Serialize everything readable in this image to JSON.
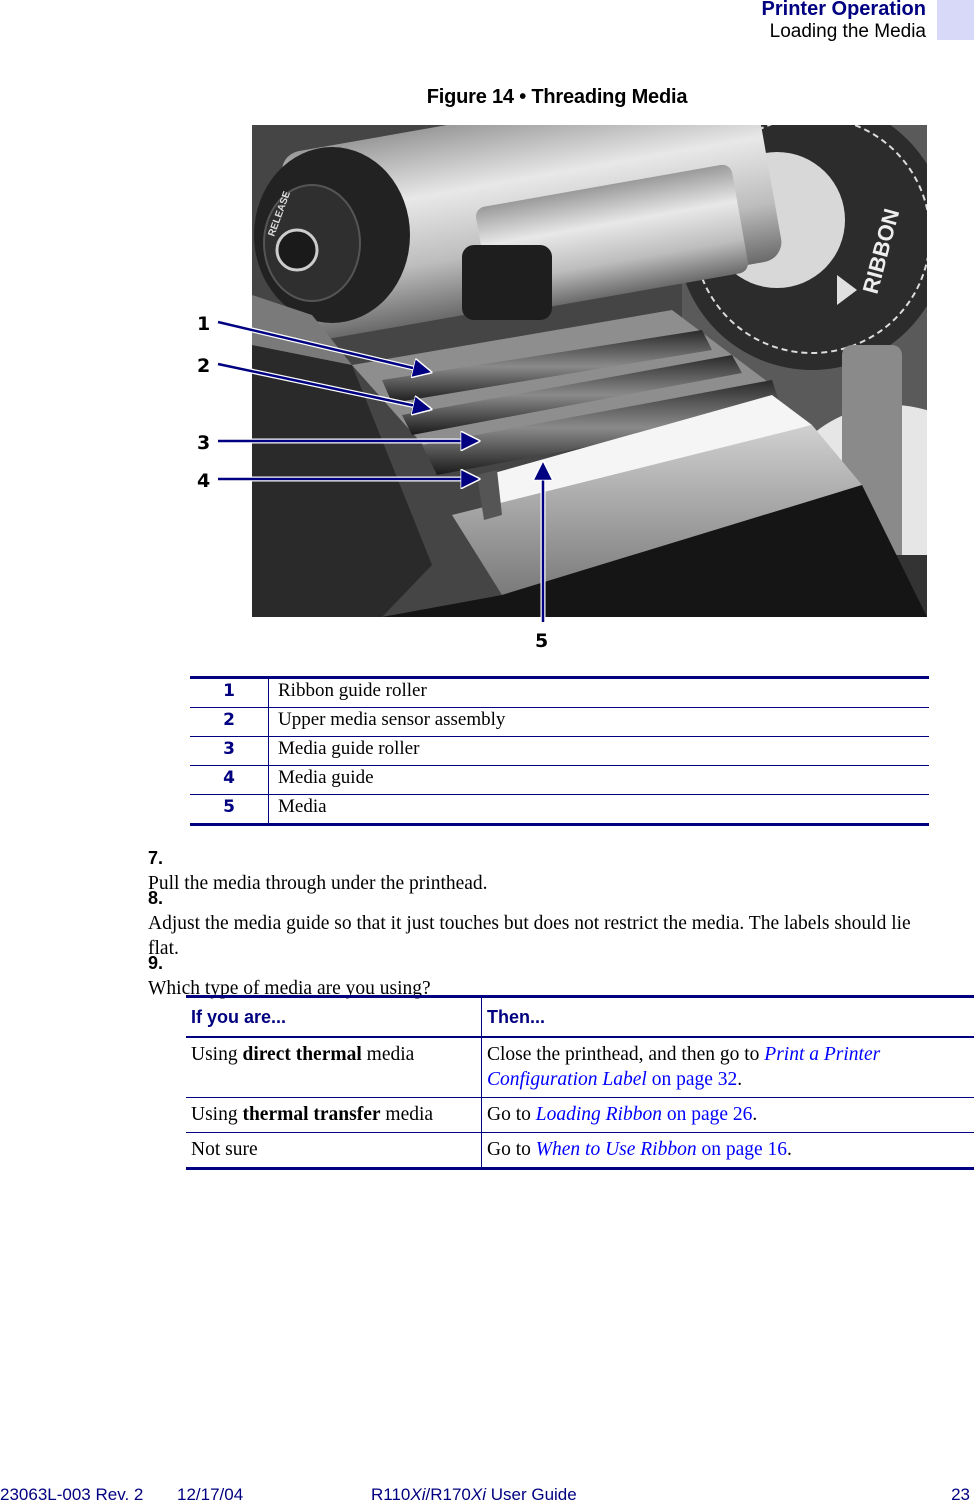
{
  "header": {
    "section": "Printer Operation",
    "subsection": "Loading the Media"
  },
  "figure": {
    "caption": "Figure 14 • Threading Media",
    "photo_text": "RIBBON",
    "knob_text": "RELEASE",
    "callouts": [
      "1",
      "2",
      "3",
      "4",
      "5"
    ],
    "legend": [
      {
        "num": "1",
        "label": "Ribbon guide roller"
      },
      {
        "num": "2",
        "label": "Upper media sensor assembly"
      },
      {
        "num": "3",
        "label": "Media guide roller"
      },
      {
        "num": "4",
        "label": "Media guide"
      },
      {
        "num": "5",
        "label": "Media"
      }
    ]
  },
  "steps": [
    {
      "num": "7.",
      "text": "Pull the media through under the printhead."
    },
    {
      "num": "8.",
      "text": "Adjust the media guide so that it just touches but does not restrict the media. The labels should lie flat."
    },
    {
      "num": "9.",
      "text": "Which type of media are you using?"
    }
  ],
  "decision_table": {
    "headers": [
      "If you are...",
      "Then..."
    ],
    "rows": [
      {
        "if_pre": "Using ",
        "if_bold": "direct thermal",
        "if_post": " media",
        "then_pre": "Close the printhead, and then go to ",
        "then_link": "Print a Printer Configuration Label",
        "then_post": " on page 32",
        "then_end": "."
      },
      {
        "if_pre": "Using ",
        "if_bold": "thermal transfer",
        "if_post": " media",
        "then_pre": "Go to ",
        "then_link": "Loading Ribbon",
        "then_post": " on page 26",
        "then_end": "."
      },
      {
        "if_pre": "Not sure",
        "if_bold": "",
        "if_post": "",
        "then_pre": "Go to ",
        "then_link": "When to Use Ribbon",
        "then_post": " on page 16",
        "then_end": "."
      }
    ]
  },
  "footer": {
    "doc_id": "23063L-003 Rev. 2",
    "date": "12/17/04",
    "guide_title_p1": "R110",
    "guide_title_p2": "Xi",
    "guide_title_p3": "/R170",
    "guide_title_p4": "Xi",
    "guide_title_p5": " User Guide",
    "page_number": "23"
  },
  "colors": {
    "accent_navy": "#000080",
    "link_blue": "#0000ff",
    "tab_lavender": "#d8d8f8"
  }
}
